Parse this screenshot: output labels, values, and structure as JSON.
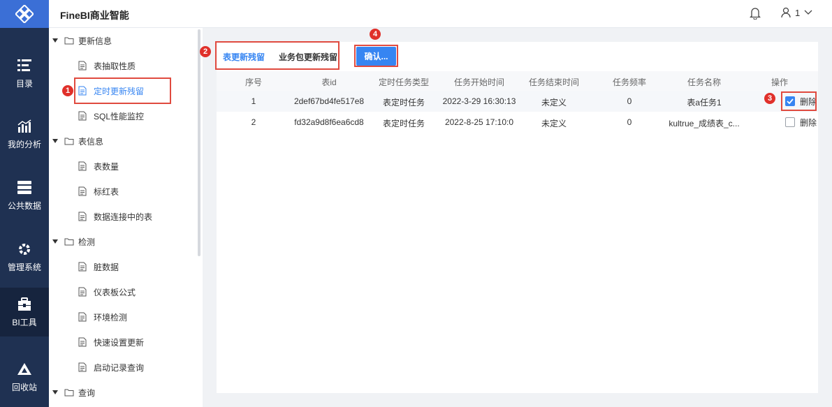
{
  "app": {
    "title": "FineBI商业智能"
  },
  "topbar": {
    "user_name": "1"
  },
  "nav": {
    "items": [
      {
        "label": "目录",
        "icon": "catalog-icon"
      },
      {
        "label": "我的分析",
        "icon": "analysis-icon"
      },
      {
        "label": "公共数据",
        "icon": "public-data-icon"
      },
      {
        "label": "管理系统",
        "icon": "gear-icon"
      },
      {
        "label": "BI工具",
        "icon": "toolbox-icon"
      },
      {
        "label": "回收站",
        "icon": "recycle-icon"
      }
    ],
    "active": "BI工具"
  },
  "tree": {
    "groups": [
      {
        "label": "更新信息",
        "children": [
          "表抽取性质",
          "定时更新残留",
          "SQL性能监控"
        ]
      },
      {
        "label": "表信息",
        "children": [
          "表数量",
          "标红表",
          "数据连接中的表"
        ]
      },
      {
        "label": "检测",
        "children": [
          "脏数据",
          "仪表板公式",
          "环境检测",
          "快速设置更新",
          "启动记录查询"
        ]
      },
      {
        "label": "查询",
        "children": []
      }
    ],
    "selected": "定时更新残留"
  },
  "tabs": {
    "table_residue": "表更新残留",
    "package_residue": "业务包更新残留"
  },
  "confirm_button": "确认...",
  "badges": [
    "1",
    "2",
    "3",
    "4"
  ],
  "table": {
    "columns": [
      "序号",
      "表id",
      "定时任务类型",
      "任务开始时间",
      "任务结束时间",
      "任务频率",
      "任务名称",
      "操作"
    ],
    "rows": [
      {
        "index": "1",
        "table_id": "2def67bd4fe517e8",
        "task_type": "表定时任务",
        "start_time": "2022-3-29 16:30:13",
        "end_time": "未定义",
        "frequency": "0",
        "task_name": "表a任务1",
        "action": "删除",
        "checked": true
      },
      {
        "index": "2",
        "table_id": "fd32a9d8f6ea6cd8",
        "task_type": "表定时任务",
        "start_time": "2022-8-25 17:10:0",
        "end_time": "未定义",
        "frequency": "0",
        "task_name": "kultrue_成绩表_c...",
        "action": "删除",
        "checked": false
      }
    ]
  },
  "colors": {
    "accent": "#3685f2",
    "nav_bg": "#1f3152",
    "highlight_red": "#e04a3f"
  }
}
